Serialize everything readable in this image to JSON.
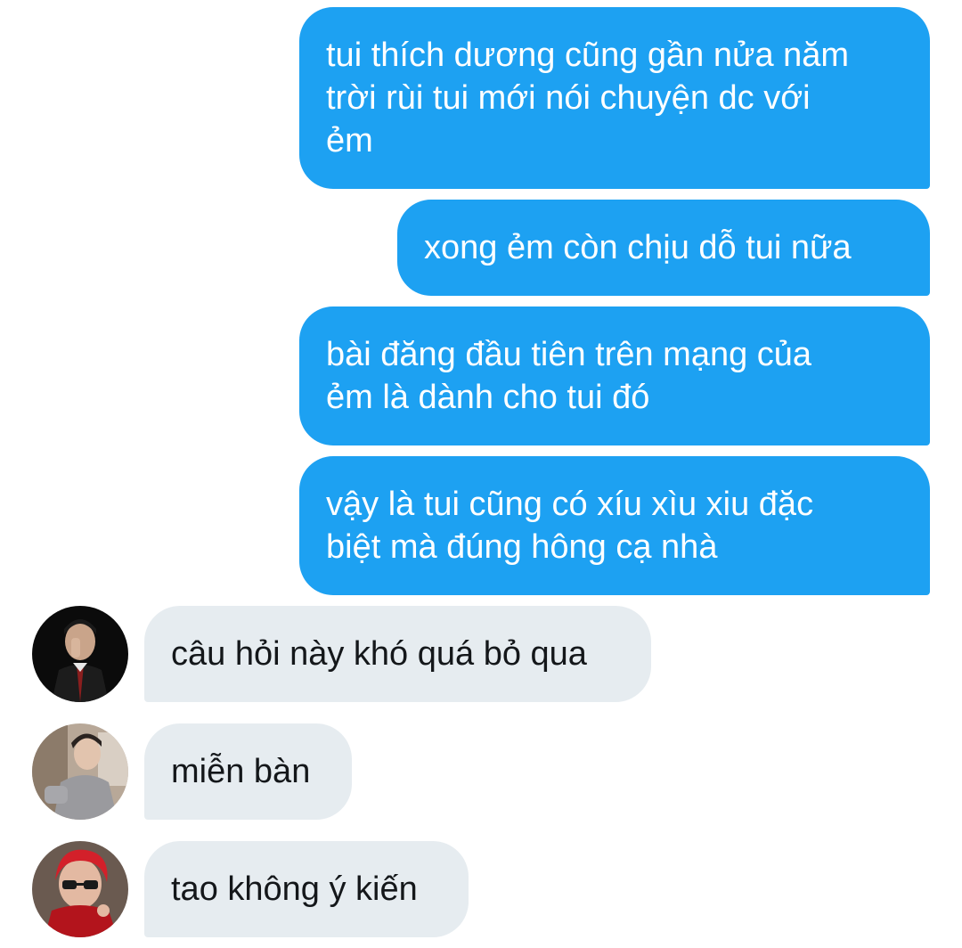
{
  "outgoing_messages": [
    "tui thích dương cũng gần nửa năm\ntrời rùi tui mới nói chuyện dc với\nẻm",
    "xong ẻm còn chịu dỗ tui nữa",
    "bài đăng đầu tiên trên mạng của\nẻm là dành cho tui đó",
    "vậy là tui cũng có xíu xìu xiu đặc\nbiệt mà đúng hông cạ nhà"
  ],
  "incoming_messages": [
    {
      "text": "câu hỏi này khó quá bỏ qua",
      "avatar": "avatar-dark-suit"
    },
    {
      "text": "miễn bàn",
      "avatar": "avatar-gray-cardigan"
    },
    {
      "text": "tao không ý kiến",
      "avatar": "avatar-red-hair-sunglasses"
    }
  ],
  "colors": {
    "outgoing_bubble": "#1da1f2",
    "incoming_bubble": "#e6ecf0",
    "outgoing_text": "#ffffff",
    "incoming_text": "#14171a"
  }
}
